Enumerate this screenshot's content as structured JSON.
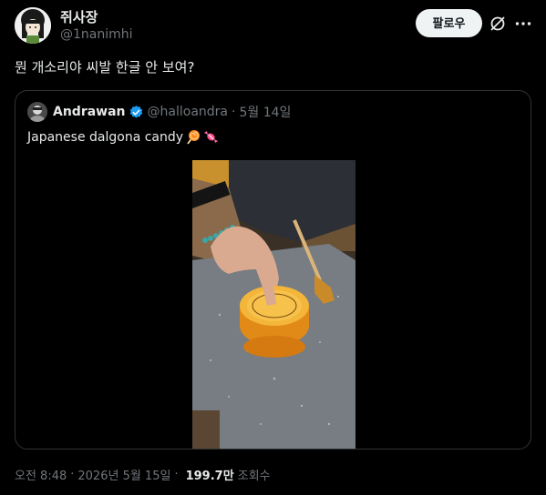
{
  "author": {
    "display_name": "쥐사장",
    "handle": "@1nanimhi"
  },
  "actions": {
    "follow_label": "팔로우",
    "grok_icon": "grok-icon",
    "more_icon": "more-icon"
  },
  "tweet": {
    "text": "뭔 개소리야 씨발 한글 안 보여?"
  },
  "quote": {
    "display_name": "Andrawan",
    "handle": "@halloandra",
    "dot": "·",
    "date": "5월 14일",
    "text": "Japanese dalgona candy",
    "emojis": [
      "lollipop-emoji",
      "candy-emoji"
    ]
  },
  "footer": {
    "time": "오전 8:48",
    "dot1": "·",
    "date": "2026년 5월 15일",
    "dot2": "·",
    "views": "199.7만",
    "views_label": "조회수"
  },
  "colors": {
    "background": "#000000",
    "text": "#e7e9ea",
    "secondary": "#71767b",
    "border": "#2f3336",
    "verified": "#1d9bf0",
    "follow_bg": "#eff3f4"
  }
}
